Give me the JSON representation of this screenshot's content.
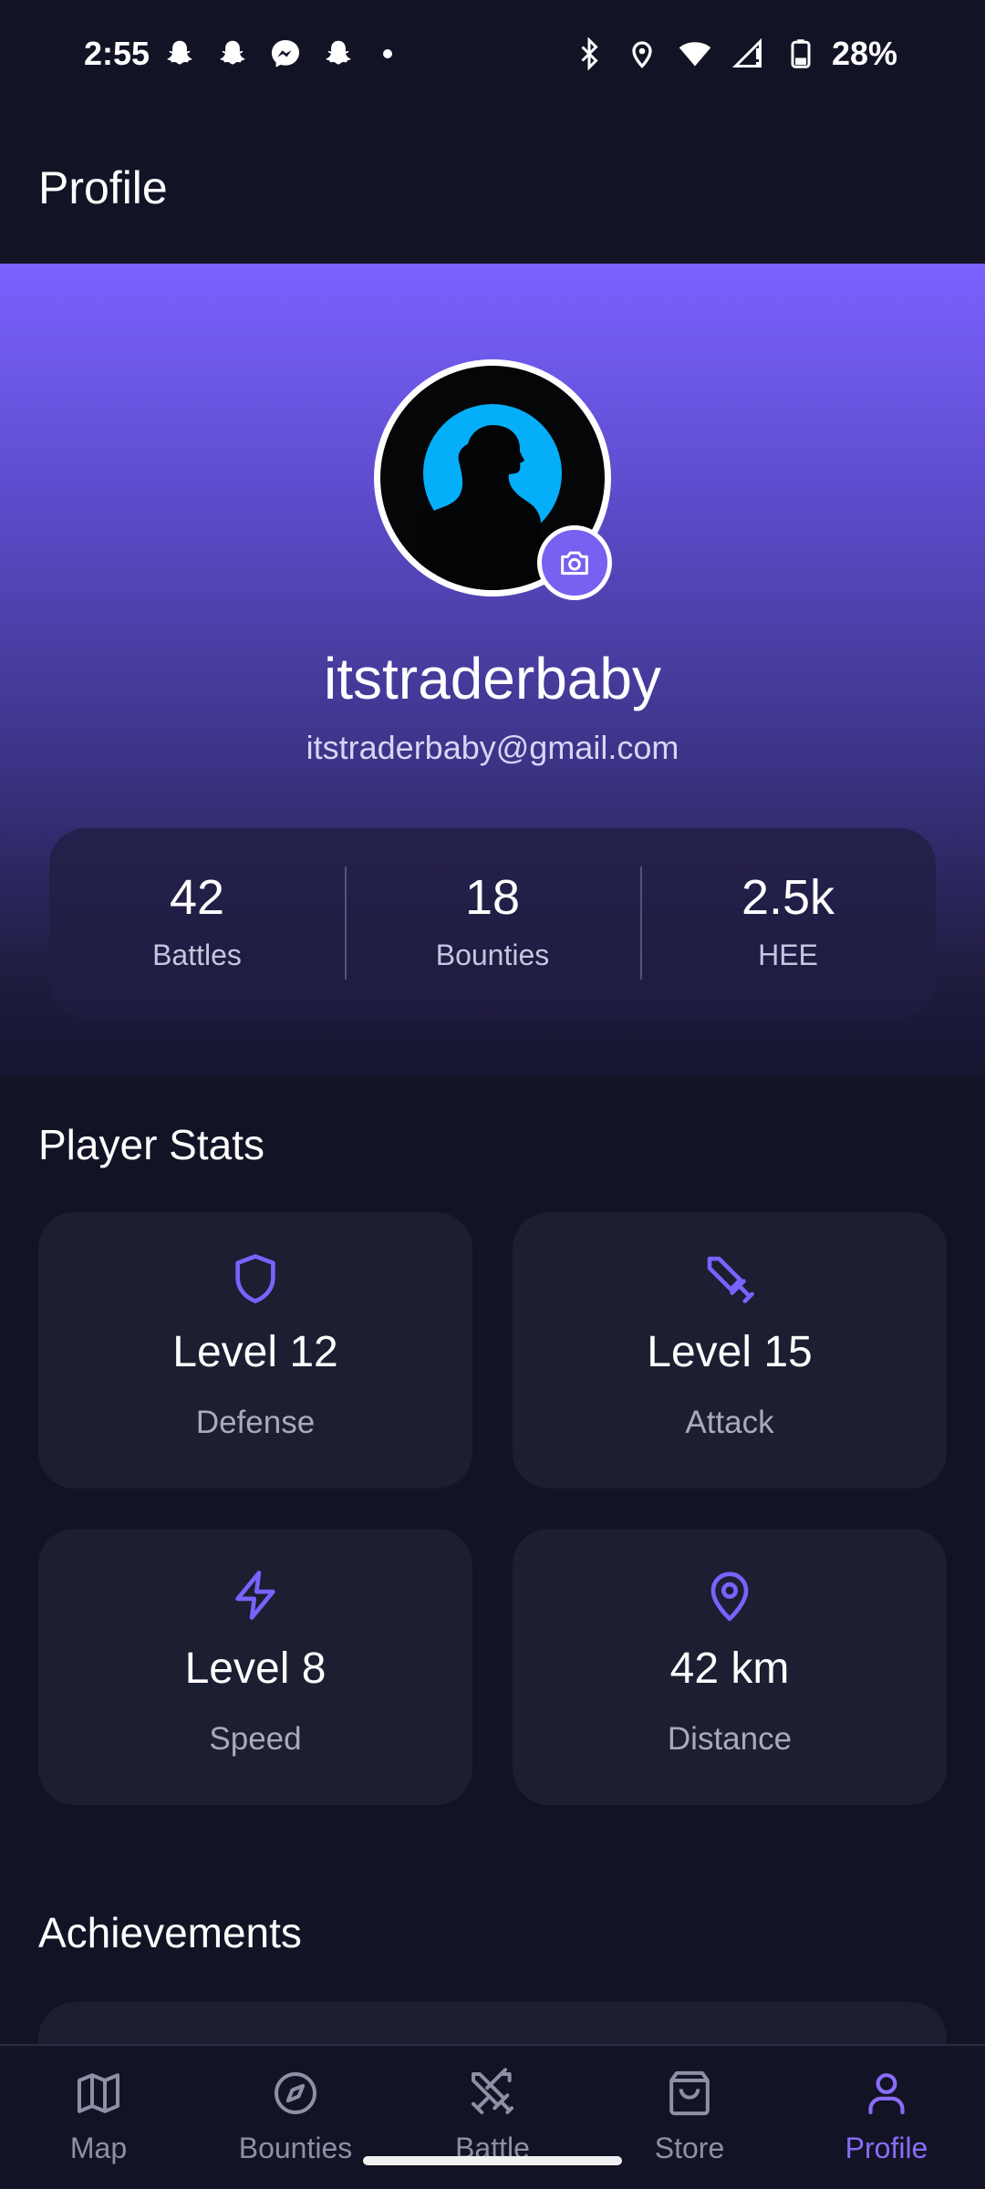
{
  "status_bar": {
    "time": "2:55",
    "battery": "28%",
    "left_icons": [
      "snapchat-icon",
      "snapchat-icon",
      "messenger-icon",
      "snapchat-icon"
    ],
    "right_icons": [
      "bluetooth-icon",
      "location-icon",
      "wifi-icon",
      "signal-icon",
      "battery-icon"
    ]
  },
  "app_bar": {
    "title": "Profile"
  },
  "profile": {
    "username": "itstraderbaby",
    "email": "itstraderbaby@gmail.com",
    "stats": [
      {
        "value": "42",
        "label": "Battles"
      },
      {
        "value": "18",
        "label": "Bounties"
      },
      {
        "value": "2.5k",
        "label": "HEE"
      }
    ]
  },
  "player_stats": {
    "title": "Player Stats",
    "cards": [
      {
        "icon": "shield-icon",
        "value": "Level 12",
        "label": "Defense"
      },
      {
        "icon": "sword-icon",
        "value": "Level 15",
        "label": "Attack"
      },
      {
        "icon": "lightning-icon",
        "value": "Level 8",
        "label": "Speed"
      },
      {
        "icon": "map-pin-icon",
        "value": "42 km",
        "label": "Distance"
      }
    ]
  },
  "achievements": {
    "title": "Achievements"
  },
  "bottom_nav": {
    "items": [
      {
        "label": "Map",
        "icon": "map-icon"
      },
      {
        "label": "Bounties",
        "icon": "compass-icon"
      },
      {
        "label": "Battle",
        "icon": "crossed-swords-icon"
      },
      {
        "label": "Store",
        "icon": "shopping-bag-icon"
      },
      {
        "label": "Profile",
        "icon": "user-icon",
        "active": true
      }
    ]
  },
  "colors": {
    "background": "#121426",
    "accent": "#7a62ff",
    "card": "#1c1e31",
    "muted_text": "#a9abbc"
  }
}
